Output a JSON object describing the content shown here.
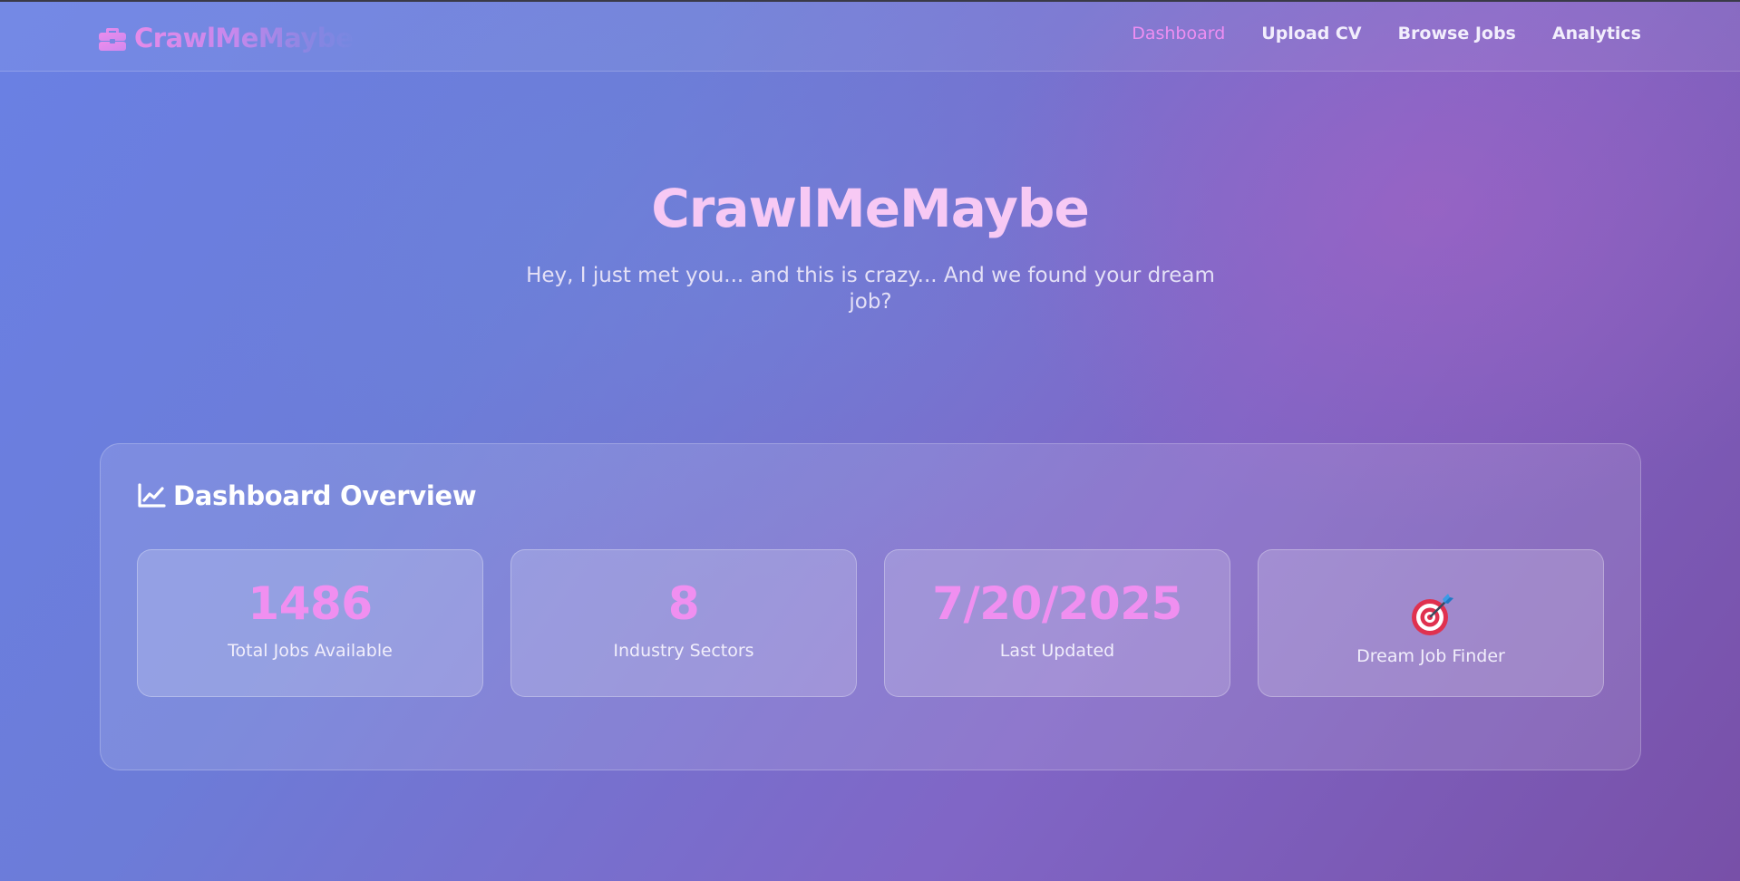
{
  "nav": {
    "brand_icon": "briefcase-icon",
    "brand_name": "CrawlMeMaybe",
    "links": [
      {
        "label": "Dashboard",
        "active": true
      },
      {
        "label": "Upload CV",
        "active": false
      },
      {
        "label": "Browse Jobs",
        "active": false
      },
      {
        "label": "Analytics",
        "active": false
      }
    ]
  },
  "hero": {
    "title": "CrawlMeMaybe",
    "subtitle": "Hey, I just met you... and this is crazy... And we found your dream job?"
  },
  "overview": {
    "icon": "line-chart-icon",
    "title": "Dashboard Overview",
    "cards": [
      {
        "value": "1486",
        "label": "Total Jobs Available"
      },
      {
        "value": "8",
        "label": "Industry Sectors"
      },
      {
        "value": "7/20/2025",
        "label": "Last Updated"
      },
      {
        "icon": "target-dart-icon",
        "label": "Dream Job Finder"
      }
    ]
  },
  "colors": {
    "accent": "#ee8ef2",
    "hero_title": "#f7c9f4",
    "background_start": "#6a80e4",
    "background_end": "#7850a8"
  }
}
